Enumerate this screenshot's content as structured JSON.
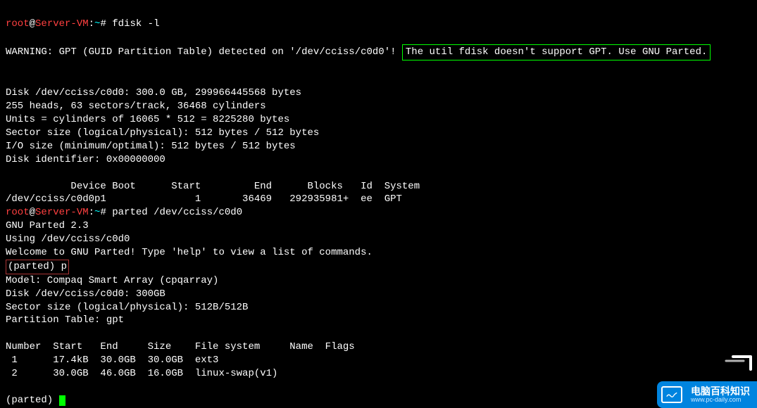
{
  "prompt1": {
    "user": "root",
    "at": "@",
    "host": "Server-VM",
    "sep": ":",
    "tilde": "~",
    "hash": "# ",
    "cmd": "fdisk -l"
  },
  "blank": "",
  "warning_prefix": "WARNING: GPT (GUID Partition Table) detected on '/dev/cciss/c0d0'! ",
  "warning_box": "The util fdisk doesn't support GPT. Use GNU Parted.",
  "disk_info": {
    "l1": "Disk /dev/cciss/c0d0: 300.0 GB, 299966445568 bytes",
    "l2": "255 heads, 63 sectors/track, 36468 cylinders",
    "l3": "Units = cylinders of 16065 * 512 = 8225280 bytes",
    "l4": "Sector size (logical/physical): 512 bytes / 512 bytes",
    "l5": "I/O size (minimum/optimal): 512 bytes / 512 bytes",
    "l6": "Disk identifier: 0x00000000"
  },
  "table_header": "           Device Boot      Start         End      Blocks   Id  System",
  "table_row1": "/dev/cciss/c0d0p1               1       36469   292935981+  ee  GPT",
  "prompt2": {
    "user": "root",
    "at": "@",
    "host": "Server-VM",
    "sep": ":",
    "tilde": "~",
    "hash": "# ",
    "cmd": "parted /dev/cciss/c0d0"
  },
  "parted": {
    "l1": "GNU Parted 2.3",
    "l2": "Using /dev/cciss/c0d0",
    "l3": "Welcome to GNU Parted! Type 'help' to view a list of commands.",
    "prompt_p": "(parted) p",
    "l4": "Model: Compaq Smart Array (cpqarray)",
    "l5": "Disk /dev/cciss/c0d0: 300GB",
    "l6": "Sector size (logical/physical): 512B/512B",
    "l7": "Partition Table: gpt"
  },
  "ptable": {
    "header": "Number  Start   End     Size    File system     Name  Flags",
    "row1": " 1      17.4kB  30.0GB  30.0GB  ext3",
    "row2": " 2      30.0GB  46.0GB  16.0GB  linux-swap(v1)"
  },
  "final_prompt": "(parted) ",
  "watermark": {
    "cn": "电脑百科知识",
    "url": "www.pc-daily.com"
  }
}
